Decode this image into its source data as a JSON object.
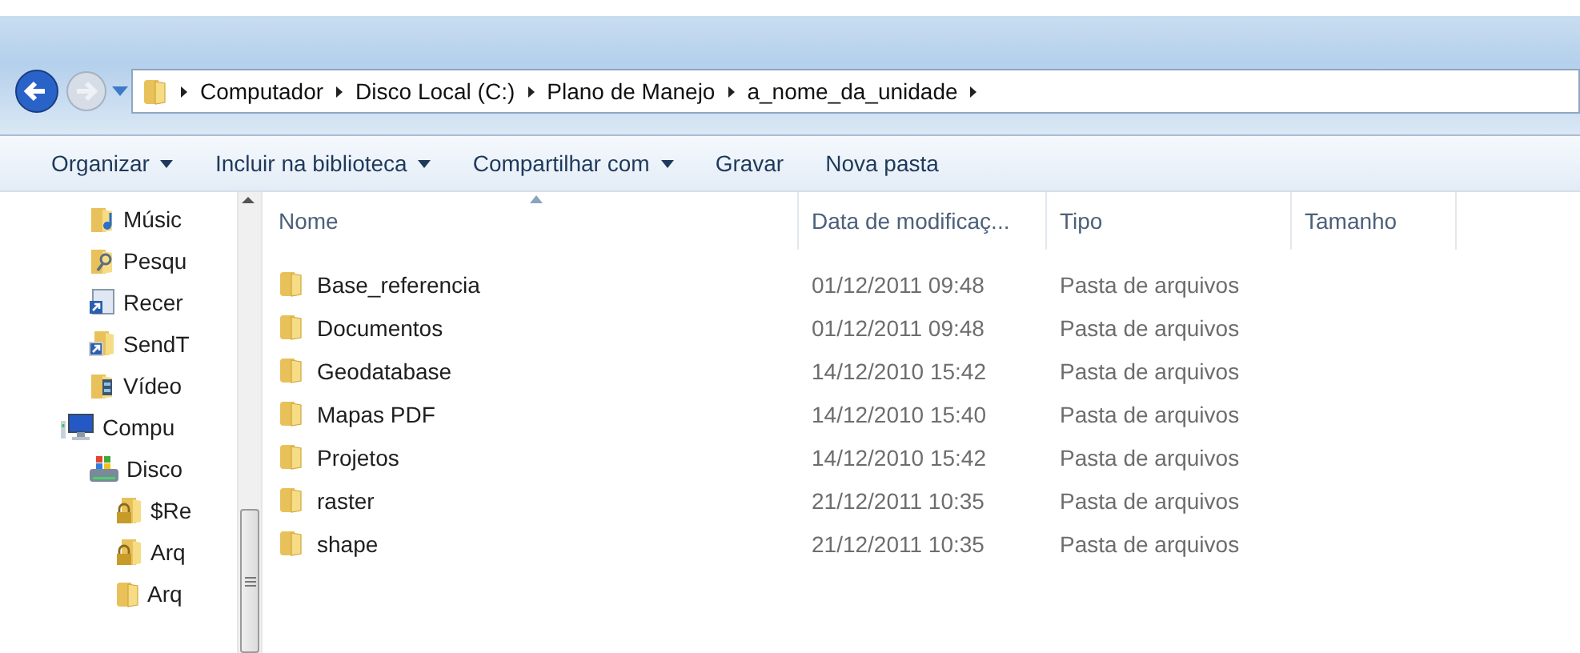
{
  "navigation": {
    "back_enabled": true,
    "forward_enabled": false
  },
  "address_bar": {
    "segments": [
      "Computador",
      "Disco Local (C:)",
      "Plano de Manejo",
      "a_nome_da_unidade"
    ]
  },
  "toolbar": [
    {
      "label": "Organizar",
      "dropdown": true
    },
    {
      "label": "Incluir na biblioteca",
      "dropdown": true
    },
    {
      "label": "Compartilhar com",
      "dropdown": true
    },
    {
      "label": "Gravar",
      "dropdown": false
    },
    {
      "label": "Nova pasta",
      "dropdown": false
    }
  ],
  "sidebar": {
    "upper_items": [
      {
        "label": "Músic",
        "kind": "music"
      },
      {
        "label": "Pesqu",
        "kind": "search"
      },
      {
        "label": "Recer",
        "kind": "recent"
      },
      {
        "label": "SendT",
        "kind": "shortcut"
      },
      {
        "label": "Vídeo",
        "kind": "video"
      }
    ],
    "tree": [
      {
        "label": "Compu",
        "kind": "computer",
        "children": [
          {
            "label": "Disco",
            "kind": "drive",
            "children": [
              {
                "label": "$Re",
                "kind": "locked"
              },
              {
                "label": "Arq",
                "kind": "locked"
              },
              {
                "label": "Arq",
                "kind": "folder"
              }
            ]
          }
        ]
      }
    ]
  },
  "table": {
    "columns": [
      {
        "label": "Nome",
        "sorted": true
      },
      {
        "label": "Data de modificaç...",
        "sorted": false
      },
      {
        "label": "Tipo",
        "sorted": false
      },
      {
        "label": "Tamanho",
        "sorted": false
      }
    ],
    "rows": [
      {
        "name": "Base_referencia",
        "date": "01/12/2011 09:48",
        "type": "Pasta de arquivos"
      },
      {
        "name": "Documentos",
        "date": "01/12/2011 09:48",
        "type": "Pasta de arquivos"
      },
      {
        "name": "Geodatabase",
        "date": "14/12/2010 15:42",
        "type": "Pasta de arquivos"
      },
      {
        "name": "Mapas PDF",
        "date": "14/12/2010 15:40",
        "type": "Pasta de arquivos"
      },
      {
        "name": "Projetos",
        "date": "14/12/2010 15:42",
        "type": "Pasta de arquivos"
      },
      {
        "name": "raster",
        "date": "21/12/2011 10:35",
        "type": "Pasta de arquivos"
      },
      {
        "name": "shape",
        "date": "21/12/2011 10:35",
        "type": "Pasta de arquivos"
      }
    ]
  }
}
